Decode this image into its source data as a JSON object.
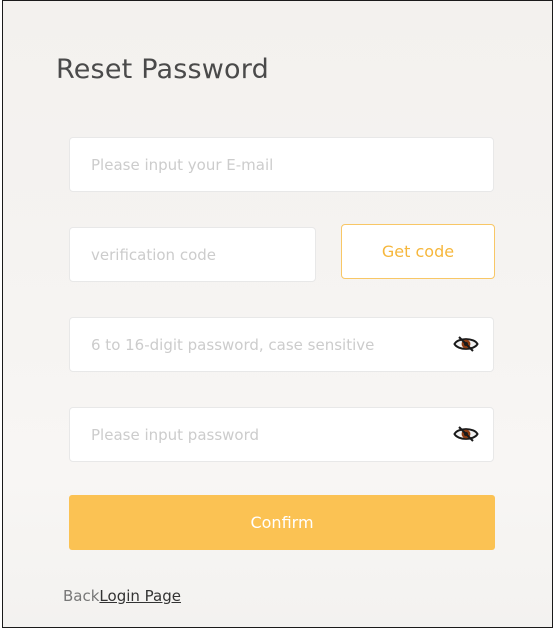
{
  "form": {
    "title": "Reset Password",
    "email_placeholder": "Please input your E-mail",
    "code_placeholder": "verification code",
    "get_code_label": "Get code",
    "password_placeholder": "6 to 16-digit password, case sensitive",
    "confirm_password_placeholder": "Please input password",
    "confirm_label": "Confirm"
  },
  "footer": {
    "back_text": "Back",
    "login_link": "Login Page"
  },
  "icons": {
    "password_toggle": "eye-slash-icon"
  },
  "colors": {
    "accent": "#fbc253",
    "accent_text": "#f6b73c"
  }
}
